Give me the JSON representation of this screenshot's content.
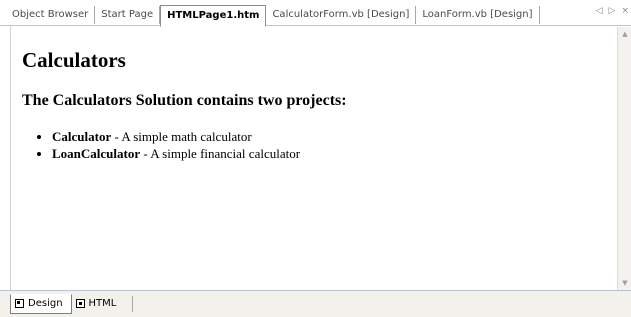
{
  "tabs": [
    {
      "label": "Object Browser",
      "active": false
    },
    {
      "label": "Start Page",
      "active": false
    },
    {
      "label": "HTMLPage1.htm",
      "active": true
    },
    {
      "label": "CalculatorForm.vb [Design]",
      "active": false
    },
    {
      "label": "LoanForm.vb [Design]",
      "active": false
    }
  ],
  "nav": {
    "prev": "◁",
    "next": "▷",
    "close": "×"
  },
  "document": {
    "heading": "Calculators",
    "intro": "The Calculators Solution contains two projects:",
    "items": [
      {
        "name": "Calculator",
        "desc": " - A simple math calculator"
      },
      {
        "name": "LoanCalculator",
        "desc": " - A simple financial calculator"
      }
    ]
  },
  "scroll": {
    "up": "▲",
    "down": "▼"
  },
  "view_tabs": [
    {
      "label": "Design",
      "active": true
    },
    {
      "label": "HTML",
      "active": false
    }
  ],
  "colors": {
    "tab_border": "#b9c4d0",
    "bottom_bg": "#f2f1ec"
  }
}
